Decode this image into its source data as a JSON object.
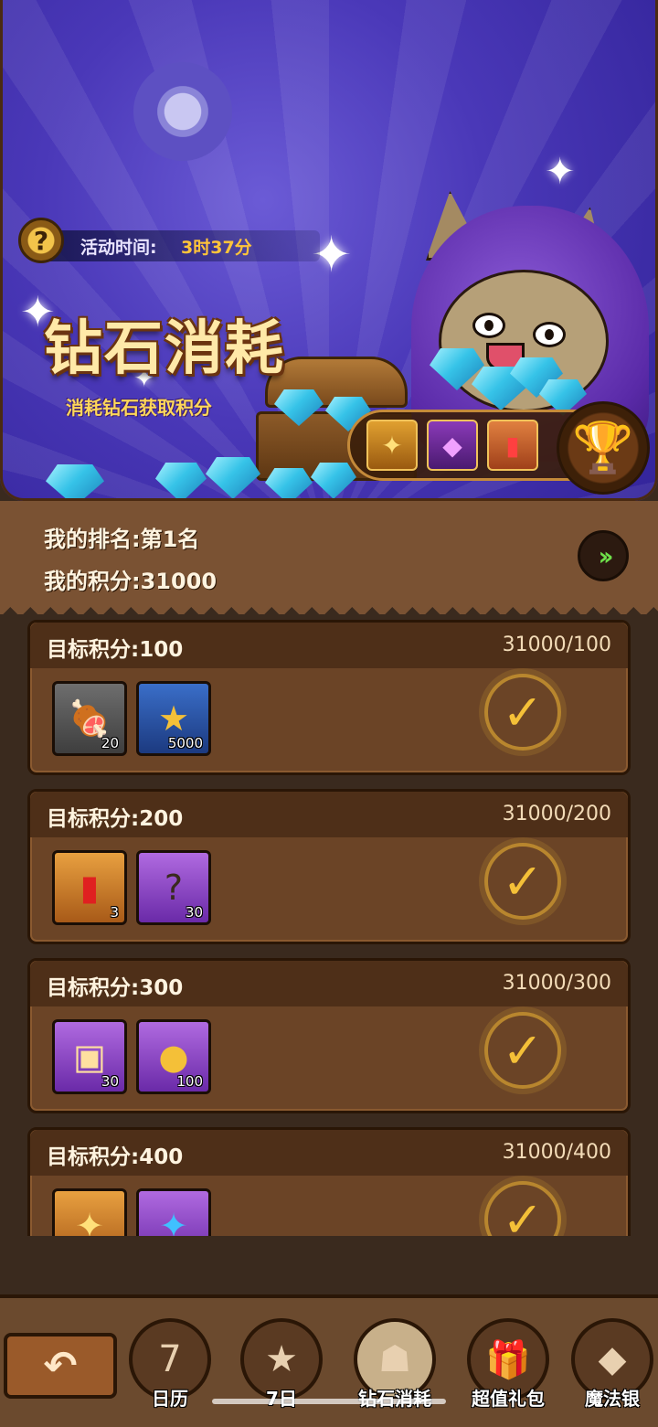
{
  "header": {
    "timer_label": "活动时间:",
    "timer_value": "3时37分",
    "title": "钻石消耗",
    "subtitle": "消耗钻石获取积分"
  },
  "rank": {
    "my_rank": "我的排名:第1名",
    "my_points": "我的积分:31000"
  },
  "tasks": [
    {
      "title": "目标积分:100",
      "progress": "31000/100",
      "items": [
        {
          "icon": "meat-icon",
          "qty": "20"
        },
        {
          "icon": "gold-coin-icon",
          "qty": "5000"
        }
      ]
    },
    {
      "title": "目标积分:200",
      "progress": "31000/200",
      "items": [
        {
          "icon": "red-potion-icon",
          "qty": "3"
        },
        {
          "icon": "mystery-scroll-icon",
          "qty": "30"
        }
      ]
    },
    {
      "title": "目标积分:300",
      "progress": "31000/300",
      "items": [
        {
          "icon": "hero-card-icon",
          "qty": "30"
        },
        {
          "icon": "all-coin-icon",
          "qty": "100"
        }
      ]
    },
    {
      "title": "目标积分:400",
      "progress": "31000/400",
      "items": [
        {
          "icon": "gold-ticket-icon",
          "qty": ""
        },
        {
          "icon": "blue-ticket-icon",
          "qty": ""
        }
      ]
    }
  ],
  "nav": {
    "items": [
      {
        "label": "日历",
        "icon": "calendar-icon",
        "glyph": "7"
      },
      {
        "label": "7日",
        "icon": "gift-box-star-icon",
        "glyph": "★"
      },
      {
        "label": "钻石消耗",
        "icon": "hooded-hero-icon",
        "glyph": "☗"
      },
      {
        "label": "超值礼包",
        "icon": "gift-icon",
        "glyph": "🎁"
      },
      {
        "label": "魔法银",
        "icon": "magic-silver-icon",
        "glyph": "◆"
      }
    ]
  },
  "colors": {
    "accent": "#ffc43a",
    "check": "#f4c038",
    "go_arrow": "#6ee04a"
  }
}
